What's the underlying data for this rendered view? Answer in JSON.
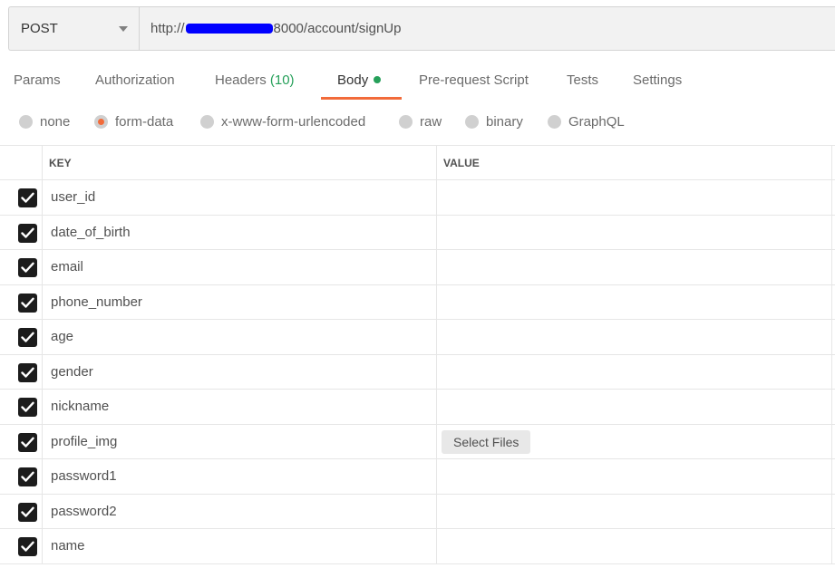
{
  "request": {
    "method": "POST",
    "url_prefix": "http://",
    "url_suffix": "8000/account/signUp"
  },
  "tabs": [
    {
      "label": "Params"
    },
    {
      "label": "Authorization"
    },
    {
      "label": "Headers",
      "count": "(10)"
    },
    {
      "label": "Body"
    },
    {
      "label": "Pre-request Script"
    },
    {
      "label": "Tests"
    },
    {
      "label": "Settings"
    }
  ],
  "body_types": [
    {
      "label": "none",
      "checked": false
    },
    {
      "label": "form-data",
      "checked": true
    },
    {
      "label": "x-www-form-urlencoded",
      "checked": false
    },
    {
      "label": "raw",
      "checked": false
    },
    {
      "label": "binary",
      "checked": false
    },
    {
      "label": "GraphQL",
      "checked": false
    }
  ],
  "table": {
    "columns": [
      "KEY",
      "VALUE"
    ],
    "rows": [
      {
        "key": "user_id",
        "checked": true
      },
      {
        "key": "date_of_birth",
        "checked": true
      },
      {
        "key": "email",
        "checked": true
      },
      {
        "key": "phone_number",
        "checked": true
      },
      {
        "key": "age",
        "checked": true
      },
      {
        "key": "gender",
        "checked": true
      },
      {
        "key": "nickname",
        "checked": true
      },
      {
        "key": "profile_img",
        "checked": true,
        "value_button": "Select Files"
      },
      {
        "key": "password1",
        "checked": true
      },
      {
        "key": "password2",
        "checked": true
      },
      {
        "key": "name",
        "checked": true
      }
    ]
  },
  "colors": {
    "accent": "#f26b3a",
    "success": "#26a05a",
    "redaction": "#0000ff"
  }
}
